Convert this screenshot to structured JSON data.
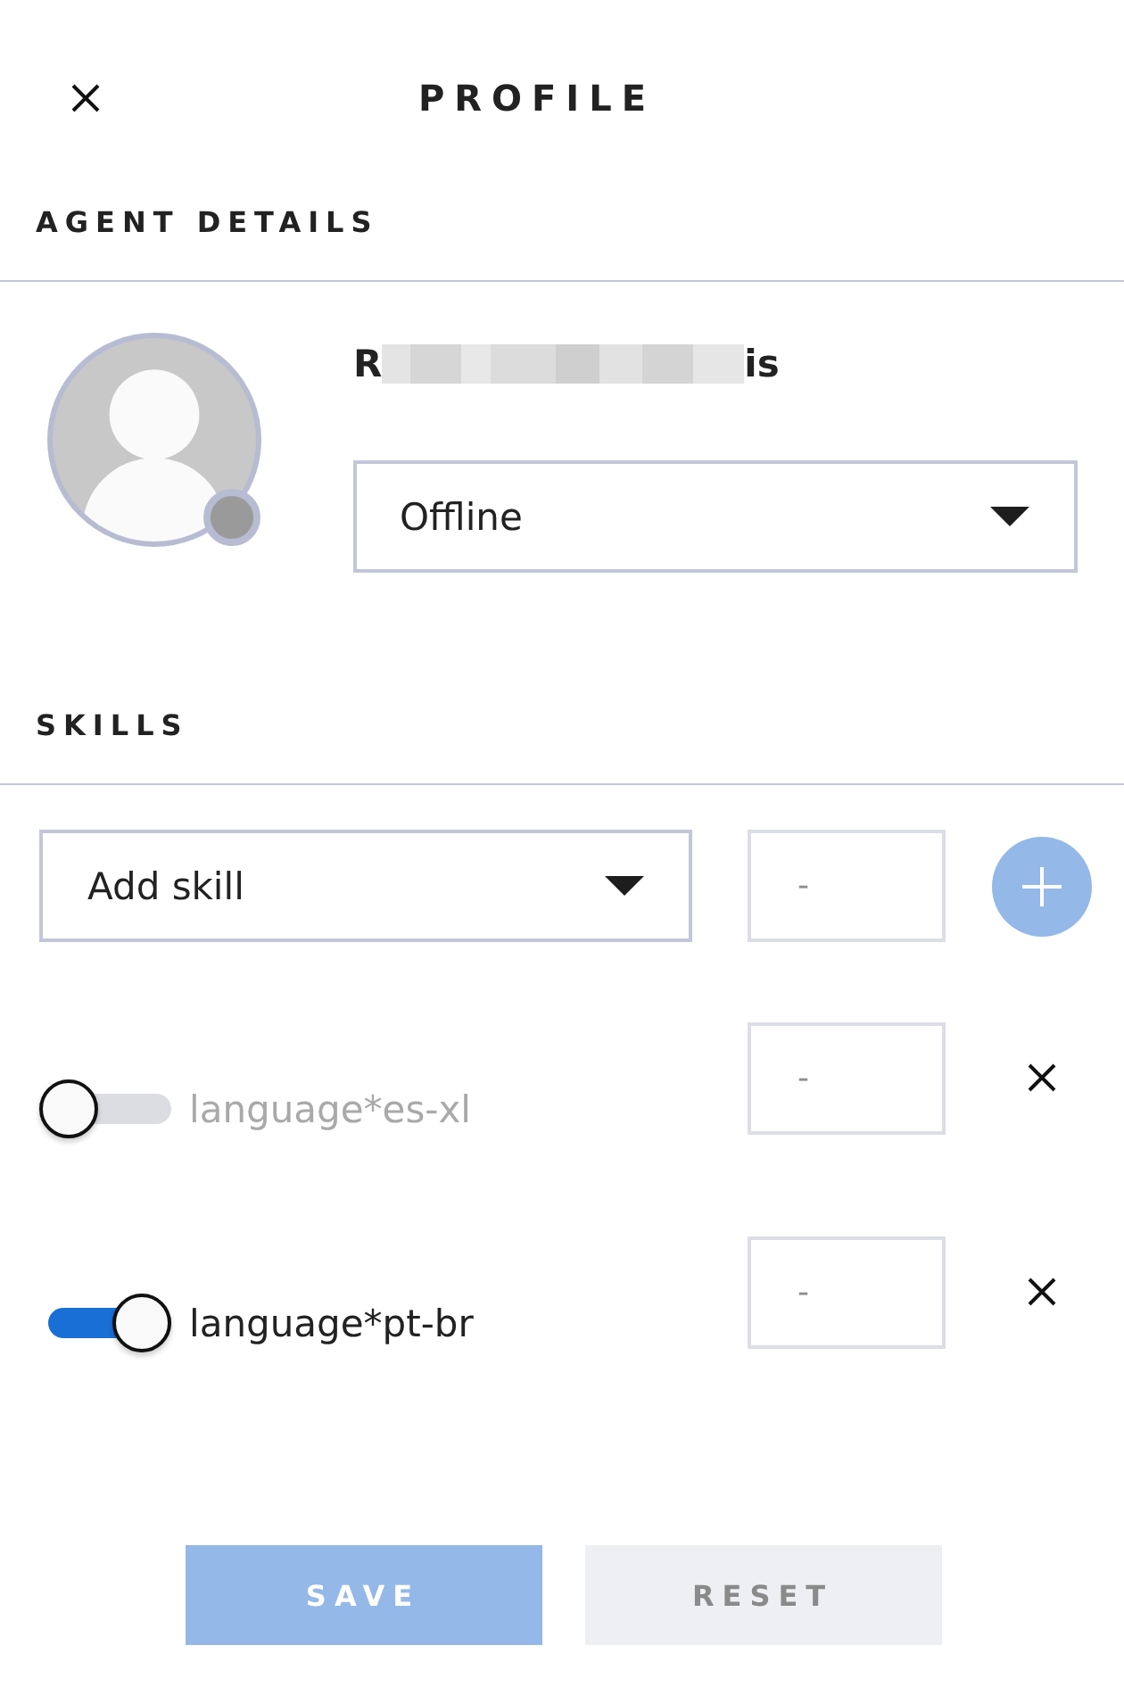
{
  "header": {
    "title": "PROFILE"
  },
  "agent_details": {
    "heading": "AGENT DETAILS",
    "name_visible_parts": [
      "R",
      "is"
    ],
    "status": {
      "value": "Offline"
    }
  },
  "skills": {
    "heading": "SKILLS",
    "add": {
      "label": "Add skill",
      "level_placeholder": "-",
      "add_disabled": true
    },
    "items": [
      {
        "label": "language*es-xl",
        "enabled": false,
        "level_placeholder": "-"
      },
      {
        "label": "language*pt-br",
        "enabled": true,
        "level_placeholder": "-"
      }
    ]
  },
  "buttons": [
    {
      "label": "SAVE",
      "kind": "primary",
      "disabled": true
    },
    {
      "label": "RESET",
      "kind": "secondary",
      "disabled": true
    }
  ]
}
